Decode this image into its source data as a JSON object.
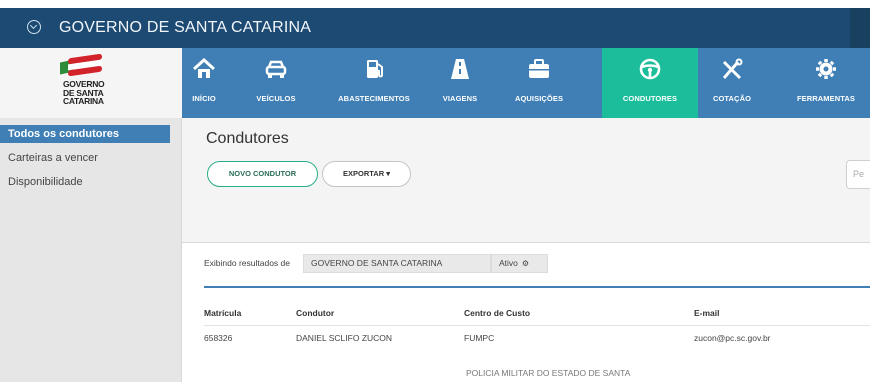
{
  "gov_bar": {
    "title": "GOVERNO DE SANTA CATARINA"
  },
  "logo": {
    "lines": [
      "GOVERNO",
      "DE SANTA",
      "CATARINA"
    ]
  },
  "nav": [
    {
      "label": "INÍCIO",
      "icon": "home-icon"
    },
    {
      "label": "VEÍCULOS",
      "icon": "car-icon"
    },
    {
      "label": "ABASTECIMENTOS",
      "icon": "fuel-pump-icon"
    },
    {
      "label": "VIAGENS",
      "icon": "road-icon"
    },
    {
      "label": "AQUISIÇÕES",
      "icon": "briefcase-icon"
    },
    {
      "label": "CONDUTORES",
      "icon": "steering-wheel-icon",
      "active": true
    },
    {
      "label": "COTAÇÃO",
      "icon": "tools-icon"
    },
    {
      "label": "FERRAMENTAS",
      "icon": "gear-icon"
    }
  ],
  "sidebar": {
    "items": [
      {
        "label": "Todos os condutores",
        "active": true
      },
      {
        "label": "Carteiras a vencer"
      },
      {
        "label": "Disponibilidade"
      }
    ]
  },
  "main": {
    "title": "Condutores",
    "new_button": "NOVO CONDUTOR",
    "export_button": "EXPORTAR ▾",
    "search_placeholder": "Pe"
  },
  "filters": {
    "prefix": "Exibindo resultados de",
    "org": "GOVERNO DE SANTA CATARINA",
    "status": "Ativo"
  },
  "table": {
    "headers": [
      "Matrícula",
      "Condutor",
      "Centro de Custo",
      "E-mail"
    ],
    "rows": [
      {
        "matricula": "658326",
        "condutor": "DANIEL SCLIFO ZUCON",
        "centro": "FUMPC",
        "email": "zucon@pc.sc.gov.br"
      }
    ],
    "partial_row": {
      "centro": "POLICIA MILITAR DO ESTADO DE SANTA"
    }
  },
  "colors": {
    "gov_bar": "#1d4a73",
    "nav": "#3f7fb5",
    "nav_active": "#1bbd9b",
    "link": "#2f78c4"
  }
}
